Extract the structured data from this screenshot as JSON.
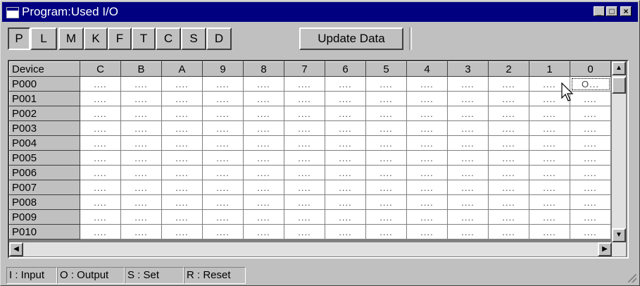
{
  "window": {
    "title": "Program:Used I/O"
  },
  "title_buttons": {
    "minimize": "_",
    "maximize": "□",
    "close": "×"
  },
  "tabs": [
    {
      "label": "P"
    },
    {
      "label": "L"
    },
    {
      "label": "M"
    },
    {
      "label": "K"
    },
    {
      "label": "F"
    },
    {
      "label": "T"
    },
    {
      "label": "C"
    },
    {
      "label": "S"
    },
    {
      "label": "D"
    }
  ],
  "update_button": "Update Data",
  "grid": {
    "device_header": "Device",
    "columns": [
      "C",
      "B",
      "A",
      "9",
      "8",
      "7",
      "6",
      "5",
      "4",
      "3",
      "2",
      "1",
      "0"
    ],
    "rows": [
      {
        "device": "P000",
        "cells": [
          "....",
          "....",
          "....",
          "....",
          "....",
          "....",
          "....",
          "....",
          "....",
          "....",
          "....",
          "....",
          "O..."
        ]
      },
      {
        "device": "P001",
        "cells": [
          "....",
          "....",
          "....",
          "....",
          "....",
          "....",
          "....",
          "....",
          "....",
          "....",
          "....",
          "....",
          "...."
        ]
      },
      {
        "device": "P002",
        "cells": [
          "....",
          "....",
          "....",
          "....",
          "....",
          "....",
          "....",
          "....",
          "....",
          "....",
          "....",
          "....",
          "...."
        ]
      },
      {
        "device": "P003",
        "cells": [
          "....",
          "....",
          "....",
          "....",
          "....",
          "....",
          "....",
          "....",
          "....",
          "....",
          "....",
          "....",
          "...."
        ]
      },
      {
        "device": "P004",
        "cells": [
          "....",
          "....",
          "....",
          "....",
          "....",
          "....",
          "....",
          "....",
          "....",
          "....",
          "....",
          "....",
          "...."
        ]
      },
      {
        "device": "P005",
        "cells": [
          "....",
          "....",
          "....",
          "....",
          "....",
          "....",
          "....",
          "....",
          "....",
          "....",
          "....",
          "....",
          "...."
        ]
      },
      {
        "device": "P006",
        "cells": [
          "....",
          "....",
          "....",
          "....",
          "....",
          "....",
          "....",
          "....",
          "....",
          "....",
          "....",
          "....",
          "...."
        ]
      },
      {
        "device": "P007",
        "cells": [
          "....",
          "....",
          "....",
          "....",
          "....",
          "....",
          "....",
          "....",
          "....",
          "....",
          "....",
          "....",
          "...."
        ]
      },
      {
        "device": "P008",
        "cells": [
          "....",
          "....",
          "....",
          "....",
          "....",
          "....",
          "....",
          "....",
          "....",
          "....",
          "....",
          "....",
          "...."
        ]
      },
      {
        "device": "P009",
        "cells": [
          "....",
          "....",
          "....",
          "....",
          "....",
          "....",
          "....",
          "....",
          "....",
          "....",
          "....",
          "....",
          "...."
        ]
      },
      {
        "device": "P010",
        "cells": [
          "....",
          "....",
          "....",
          "....",
          "....",
          "....",
          "....",
          "....",
          "....",
          "....",
          "....",
          "....",
          "...."
        ]
      }
    ]
  },
  "scroll": {
    "up": "▲",
    "down": "▼",
    "left": "◀",
    "right": "▶"
  },
  "status": [
    "I : Input",
    "O : Output",
    "S : Set",
    "R : Reset"
  ]
}
